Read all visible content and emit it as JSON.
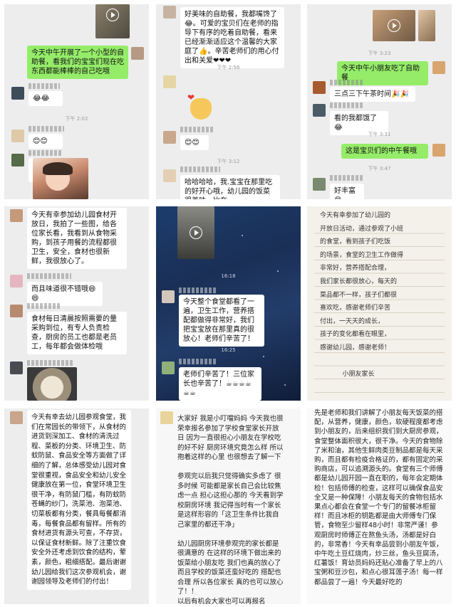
{
  "panel1": {
    "msg1": "今天中午开展了一个小型的自助餐，看我们的宝宝们现在吃东西都能棒棒的自己吃哦",
    "emoji_laugh": "😂😂",
    "emoji_smiles": "😊😊",
    "time1": "下午 2:02",
    "emoji_thumbs": "👍👍👍🌹🌹",
    "emoji_flowers": "🌹🌹"
  },
  "panel2": {
    "msg1": "好美味的自助餐，我都嘴馋了😂。可爱的宝贝们在老师的指导下有序的吃着自助餐，看来已经渐渐适应这个温馨的大家庭了👍。辛苦老师们的用心付出和关爱❤❤❤",
    "time1": "下午 2:56",
    "time2": "下午 3:12",
    "emoji_smiles": "😊😊",
    "msg2": "哈哈哈哈，我.宝宝在那里吃的好开心哦，幼儿园的饭菜很美味，比在"
  },
  "panel3": {
    "time1": "下午 3:23",
    "msg1": "今天中午小朋友吃了自助餐",
    "msg2": "三点三下午茶时间🎉🎉",
    "msg3": "看的我都饿了😂",
    "time2": "下午 3:31",
    "msg4": "这是宝贝们的中午餐哦",
    "time3": "下午 3:47",
    "msg5": "好丰富😊"
  },
  "panel4": {
    "msg1": "今天有幸参加幼儿园食材开放日，我拍了一些图，给各位家长看，我看到从食物采购，到孩子用餐的流程都很卫生，安全，食材也很新鲜，我很放心了。",
    "msg2": "而且味道很不错哦😄😄",
    "msg3": "食材每日清晨按照需要的量采购到位，有专人负责检查，厨房的员工也都是老员工，每年都会做体检哦"
  },
  "panel5": {
    "time1": "16:18",
    "msg1": "今天整个食堂都看了一遍，卫生工作，营养搭配都做得非常好，我们把宝宝放在那里真的很放心！老师们辛苦了！",
    "time2": "16:25",
    "msg2": "老师们辛苦了！三位家长也辛苦了！☕☕☕☕☕☕"
  },
  "panel6": {
    "handwriting": "今天有幸参加了幼儿园的\n开放日活动，通过参观了小班\n的食堂，看到孩子们吃饭\n的场景，食堂的卫生工作做得\n非常好，营养搭配合理，\n我们家长都很放心，每天的\n菜品都不一样，孩子们都很\n喜欢吃，感谢老师们辛苦\n付出，一天天的成长，\n孩子的变化都看在眼里，\n感谢幼儿园，感谢老师！\n\n           小朋友家长"
  },
  "panel7": {
    "msg": "今天有幸去幼儿园参观食堂，我们在常园长的带领下，从食材的进货到深加工、食材的清洗过程、菜板的分类、环境卫生、防蚊防鼠、食品安全等方面做了详细的了解，总体感受幼儿园对食堂很重视，食品安全和幼儿安全健康放在第一位，食堂环境卫生很干净，有防鼠门槛，有防蚊防苍蝇的纱门，洗菜池、泡菜池、切菜板都有分类，餐具每餐都消毒，每餐食品都有留样。所有的食材进货有源头可查，不存货，以保证食材新鲜。除了注重饮食安全外还考虑到饮食的结构，荤素，颜色，粗细搭配。最后谢谢幼儿园给我们这次参观机会，谢谢园领导及老师们的付出！"
  },
  "panel8": {
    "msg": "大家好 我是小叮噹妈妈 今天我也很荣幸报名参加了学校食堂家长开放日 因为一直很担心小朋友在学校吃的好不好 厨房环境究竟怎么样 所以抱着这样的心里 也很想去了解一下\n\n参观完以后我只觉得确实多虑了 很多时候 可能都是家长自己会比较焦虑一点 担心这担心那的 今天看到学校厨房环境 我记得当时有一个家长是这样形容的「这卫生条件比我自己家里的都还干净」\n\n幼儿园厨房环境参观完的家长都是很满意的 在这样的环境下做出来的饭菜给小朋友吃 我们也真的放心了 而且学校的饭菜还蛮好吃的 搭配也合理 所以各位家长 真的也可以放心了！！\n以后有机会大家也可以再报名"
  },
  "panel9": {
    "msg": "先是老师和我们讲解了小朋友每天饭菜的搭配，从营养，健康，颜色，软硬程度都考虑到小朋友的，后来组织我们到大厨房参观，食堂整体面积很大，很干净。今天的食物除了米和油，其他生鲜肉类豆制品都是每天采购，而且都有检疫合格证的，都有固定的采购商店，可以追溯源头的。食堂有三个师傅都是幼儿园开园一直在职的，每年会定期体检！包括师傅的检查，这样可以确保食品安全又是一种保障！小朋友每天的食物包括水果点心都会在食堂一个专门的留餐冰柜留样！而且冰柜的钥匙都是由大师傅专门保管，食物至少留样48小时！非常严谨！参观厨房时师傅正在熬鱼头汤，汤都是好白的，非常香！今天有幸品尝到小朋友午饭，中午吃土豆红烧肉，炒三丝，鱼头豆腐汤，红薯饭！育幼员妈妈还贴心准备了早上的八宝粥和豆沙包，和点心很耳莲子汤！每一样都品尝了一遍！今天最好吃的"
  },
  "colors": {
    "wechat_green": "#95ec69",
    "chat_bg": "#ededed",
    "night_sky": "#1a2f55"
  }
}
